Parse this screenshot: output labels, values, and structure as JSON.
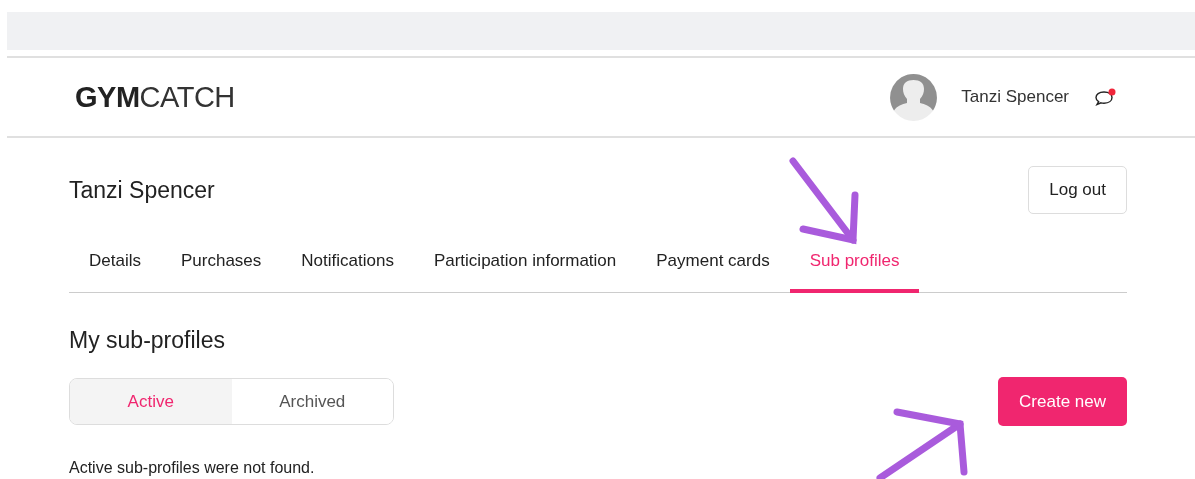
{
  "header": {
    "logo": "**GYM**CATCH",
    "user_name": "Tanzi Spencer",
    "messages_unread": true
  },
  "profile": {
    "name": "Tanzi Spencer",
    "logout": "Log out"
  },
  "tabs": [
    {
      "label": "Details",
      "selected": false
    },
    {
      "label": "Purchases",
      "selected": false
    },
    {
      "label": "Notifications",
      "selected": false
    },
    {
      "label": "Participation information",
      "selected": false
    },
    {
      "label": "Payment cards",
      "selected": false
    },
    {
      "label": "Sub profiles",
      "selected": true
    }
  ],
  "section": {
    "title": "My sub-profiles",
    "filters": [
      {
        "label": "Active",
        "selected": true
      },
      {
        "label": "Archived",
        "selected": false
      }
    ],
    "create_button": "Create new",
    "empty_message": "Active sub-profiles were not found."
  }
}
